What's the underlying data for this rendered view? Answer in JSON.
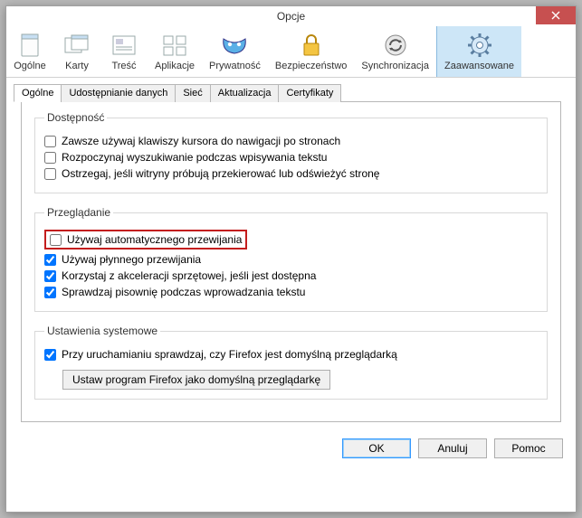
{
  "window": {
    "title": "Opcje"
  },
  "toolbar": [
    {
      "id": "general",
      "label": "Ogólne"
    },
    {
      "id": "tabs",
      "label": "Karty"
    },
    {
      "id": "content",
      "label": "Treść"
    },
    {
      "id": "apps",
      "label": "Aplikacje"
    },
    {
      "id": "privacy",
      "label": "Prywatność"
    },
    {
      "id": "security",
      "label": "Bezpieczeństwo"
    },
    {
      "id": "sync",
      "label": "Synchronizacja"
    },
    {
      "id": "advanced",
      "label": "Zaawansowane",
      "active": true
    }
  ],
  "tabs": [
    {
      "id": "general",
      "label": "Ogólne",
      "active": true
    },
    {
      "id": "data",
      "label": "Udostępnianie danych"
    },
    {
      "id": "network",
      "label": "Sieć"
    },
    {
      "id": "update",
      "label": "Aktualizacja"
    },
    {
      "id": "certs",
      "label": "Certyfikaty"
    }
  ],
  "groups": {
    "access": {
      "legend": "Dostępność",
      "items": [
        {
          "checked": false,
          "label": "Zawsze używaj klawiszy kursora do nawigacji po stronach"
        },
        {
          "checked": false,
          "label": "Rozpoczynaj wyszukiwanie podczas wpisywania tekstu"
        },
        {
          "checked": false,
          "label": "Ostrzegaj, jeśli witryny próbują przekierować lub odświeżyć stronę"
        }
      ]
    },
    "browse": {
      "legend": "Przeglądanie",
      "items": [
        {
          "checked": false,
          "label": "Używaj automatycznego przewijania",
          "highlight": true
        },
        {
          "checked": true,
          "label": "Używaj płynnego przewijania"
        },
        {
          "checked": true,
          "label": "Korzystaj z akceleracji sprzętowej, jeśli jest dostępna"
        },
        {
          "checked": true,
          "label": "Sprawdzaj pisownię podczas wprowadzania tekstu"
        }
      ]
    },
    "system": {
      "legend": "Ustawienia systemowe",
      "items": [
        {
          "checked": true,
          "label": "Przy uruchamianiu sprawdzaj, czy Firefox jest domyślną przeglądarką"
        }
      ],
      "button": "Ustaw program Firefox jako domyślną przeglądarkę"
    }
  },
  "footer": {
    "ok": "OK",
    "cancel": "Anuluj",
    "help": "Pomoc"
  }
}
